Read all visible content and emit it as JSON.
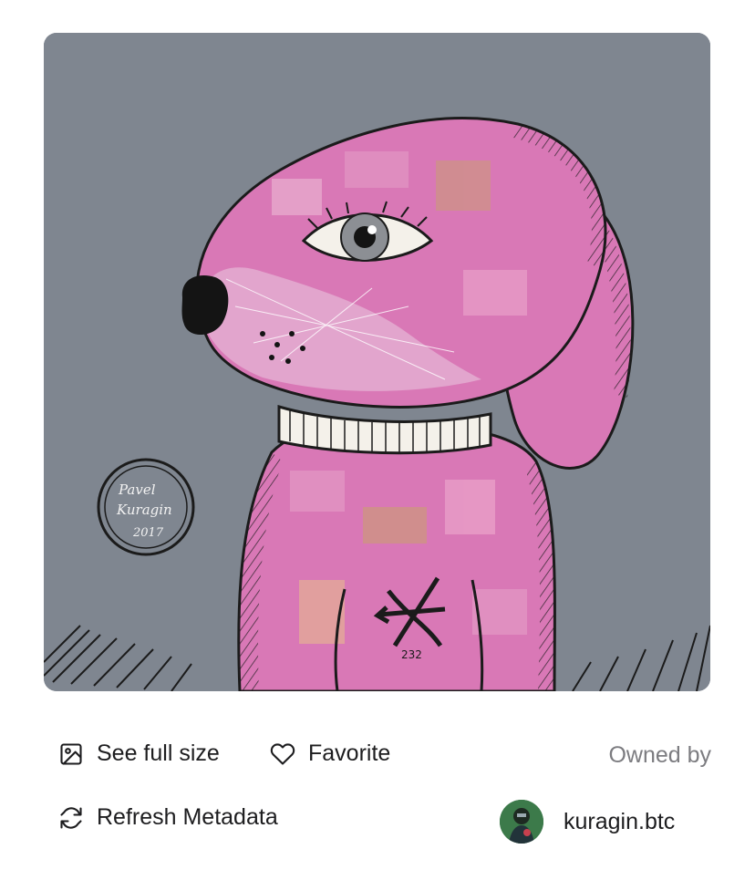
{
  "artwork": {
    "icon": "artwork-image",
    "signature_name": "Pavel Kuragin",
    "signature_year": "2017",
    "number_mark": "232",
    "colors": {
      "background": "#7f8690",
      "dog": "#d978b6",
      "ink": "#1b1b1b"
    }
  },
  "actions": {
    "see_full_size": {
      "label": "See full size",
      "icon": "image-icon"
    },
    "favorite": {
      "label": "Favorite",
      "icon": "heart-icon"
    },
    "refresh_metadata": {
      "label": "Refresh Metadata",
      "icon": "refresh-icon"
    }
  },
  "ownership": {
    "label": "Owned by",
    "owner_name": "kuragin.btc",
    "avatar_icon": "avatar-image"
  }
}
